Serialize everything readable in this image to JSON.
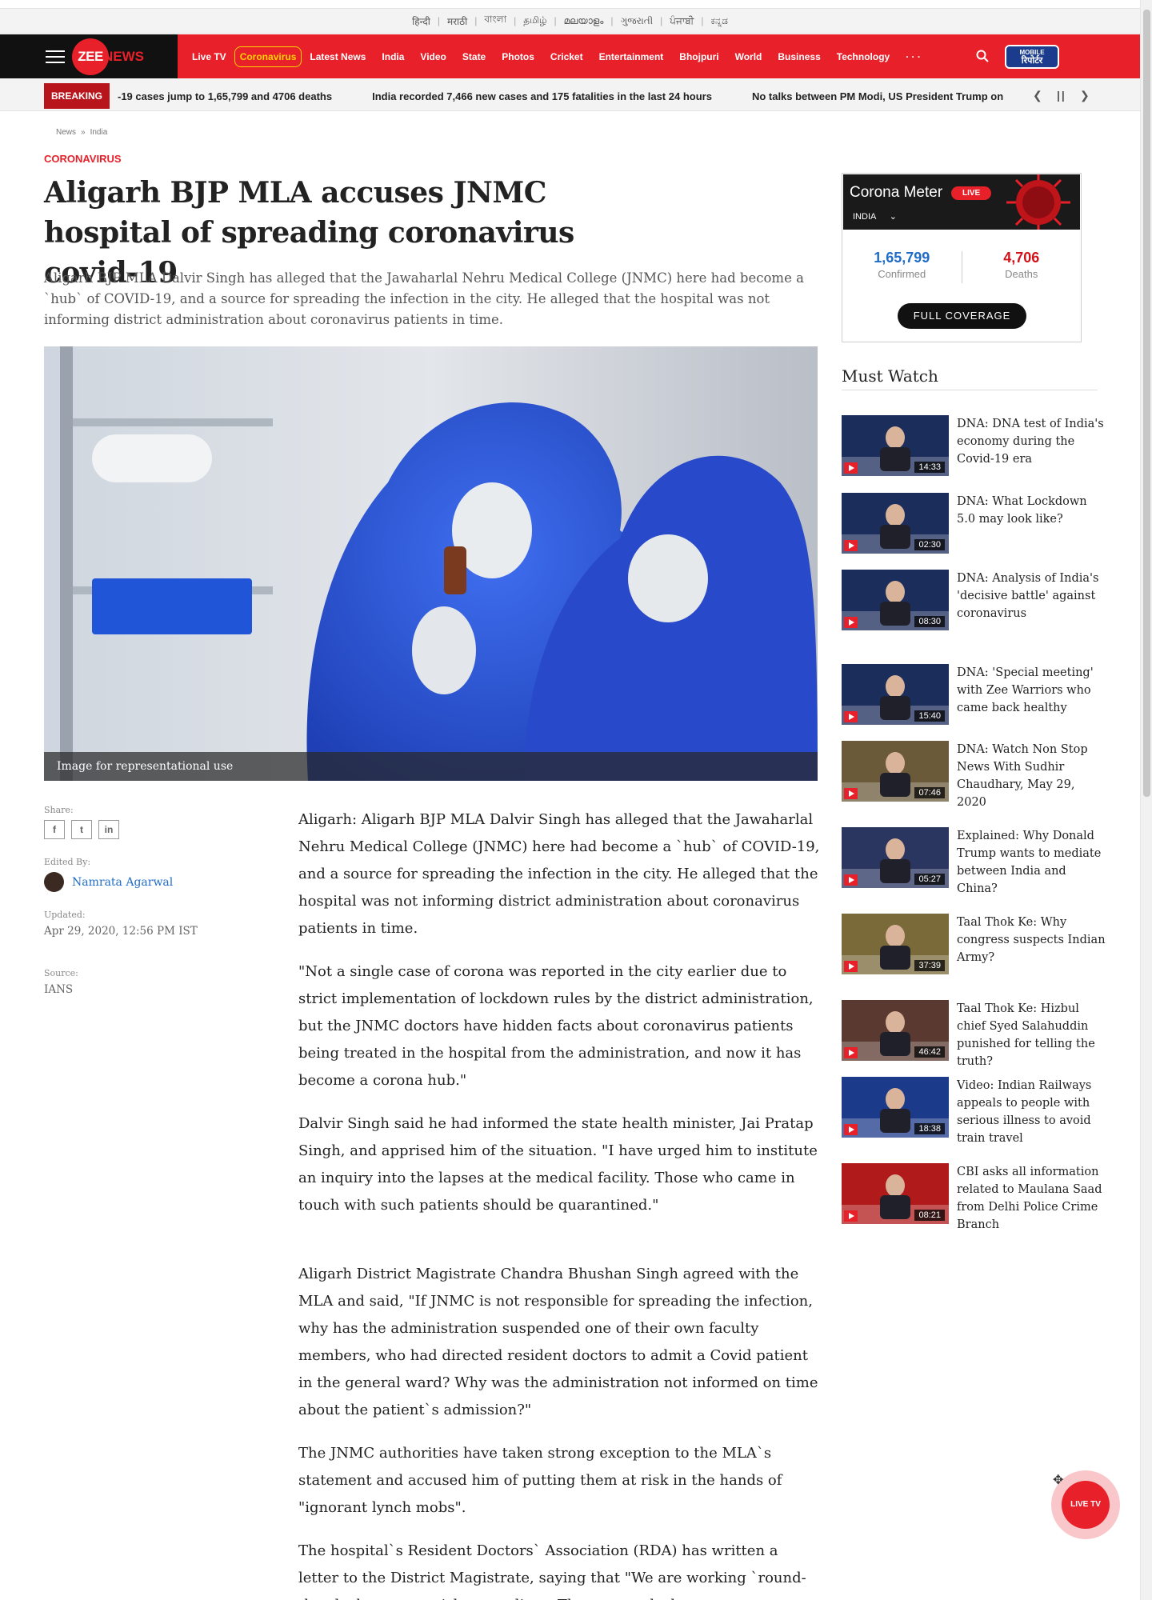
{
  "languages": [
    "हिन्दी",
    "मराठी",
    "বাংলা",
    "தமிழ்",
    "മലയാളം",
    "ગુજરાતી",
    "ਪੰਜਾਬੀ",
    "ಕನ್ನಡ"
  ],
  "logo": {
    "mark": "ZEE",
    "text": "NEWS"
  },
  "nav": {
    "items": [
      "Live TV",
      "Coronavirus",
      "Latest News",
      "India",
      "Video",
      "State",
      "Photos",
      "Cricket",
      "Entertainment",
      "Bhojpuri",
      "World",
      "Business",
      "Technology",
      "· · ·"
    ],
    "active": "Coronavirus",
    "mobile_reporter": {
      "line1": "MOBILE",
      "line2": "रिपोर्टर"
    }
  },
  "breaking": {
    "tag": "BREAKING",
    "items": [
      "-19 cases jump to 1,65,799 and 4706 deaths",
      "India recorded 7,466 new cases and 175 fatalities in the last 24 hours",
      "No talks between PM Modi, US President Trump on"
    ]
  },
  "breadcrumb": [
    "News",
    "India"
  ],
  "article": {
    "category": "CORONAVIRUS",
    "headline": "Aligarh BJP MLA accuses JNMC hospital of spreading coronavirus covid-19",
    "summary": "Aligarh BJP MLA Dalvir Singh has alleged that the Jawaharlal Nehru Medical College (JNMC) here had become a `hub` of COVID-19, and a source for spreading the infection in the city. He alleged that the hospital was not informing district administration about coronavirus patients in time.",
    "image_caption": "Image for representational use",
    "share_label": "Share:",
    "edited_label": "Edited By:",
    "editor": "Namrata Agarwal",
    "updated_label": "Updated:",
    "updated": "Apr 29, 2020, 12:56 PM IST",
    "source_label": "Source:",
    "source": "IANS",
    "paragraphs": [
      "Aligarh: Aligarh BJP MLA Dalvir Singh has alleged that the Jawaharlal Nehru Medical College (JNMC) here had become a `hub` of COVID-19, and a source for spreading the infection in the city. He alleged that the hospital was not informing district administration about coronavirus patients in time.",
      "\"Not a single case of corona was reported in the city earlier due to strict implementation of lockdown rules by the district administration, but the JNMC doctors have hidden facts about coronavirus patients being treated in the hospital from the administration, and now it has become a corona hub.\"",
      "Dalvir Singh said he had informed the state health minister, Jai Pratap Singh, and apprised him of the situation. \"I have urged him to institute an inquiry into the lapses at the medical facility. Those who came in touch with such patients should be quarantined.\"",
      "Aligarh District Magistrate Chandra Bhushan Singh agreed with the MLA and said, \"If JNMC is not responsible for spreading the infection, why has the administration suspended one of their own faculty members, who had directed resident doctors to admit a Covid patient in the general ward? Why was the administration not informed on time about the patient`s admission?\"",
      "The JNMC authorities have taken strong exception to the MLA`s statement and accused him of putting them at risk in the hands of \"ignorant lynch mobs\".",
      "The hospital`s Resident Doctors` Association (RDA) has written a letter to the District Magistrate, saying that \"We are working `round-the-clock at grave risk to our lives. These remarks have put us at a grave risk of"
    ]
  },
  "corona_meter": {
    "title": "Corona Meter",
    "live": "LIVE",
    "region": "INDIA",
    "confirmed": "1,65,799",
    "confirmed_label": "Confirmed",
    "deaths": "4,706",
    "deaths_label": "Deaths",
    "button": "FULL COVERAGE"
  },
  "must_watch": {
    "title": "Must Watch",
    "items": [
      {
        "title": "DNA: DNA test of India's economy during the Covid-19 era",
        "duration": "14:33"
      },
      {
        "title": "DNA: What Lockdown 5.0 may look like?",
        "duration": "02:30"
      },
      {
        "title": "DNA: Analysis of India's 'decisive battle' against coronavirus",
        "duration": "08:30"
      },
      {
        "title": "DNA: 'Special meeting' with Zee Warriors who came back healthy",
        "duration": "15:40"
      },
      {
        "title": "DNA: Watch Non Stop News With Sudhir Chaudhary, May 29, 2020",
        "duration": "07:46"
      },
      {
        "title": "Explained: Why Donald Trump wants to mediate between India and China?",
        "duration": "05:27"
      },
      {
        "title": "Taal Thok Ke: Why congress suspects Indian Army?",
        "duration": "37:39"
      },
      {
        "title": "Taal Thok Ke: Hizbul chief Syed Salahuddin punished for telling the truth?",
        "duration": "46:42"
      },
      {
        "title": "Video: Indian Railways appeals to people with serious illness to avoid train travel",
        "duration": "18:38"
      },
      {
        "title": "CBI asks all information related to Maulana Saad from Delhi Police Crime Branch",
        "duration": "08:21"
      }
    ]
  },
  "live_tv": "LIVE TV",
  "colors": {
    "brand_red": "#e8202a",
    "breaking_red": "#b8141c",
    "link_blue": "#1f6cc8"
  }
}
